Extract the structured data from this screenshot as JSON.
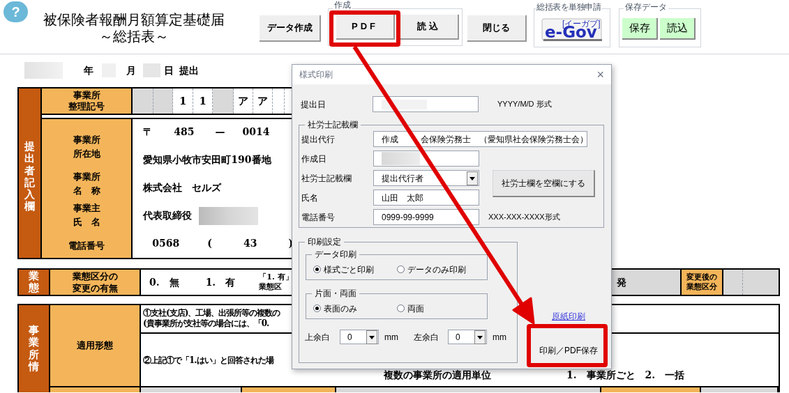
{
  "header": {
    "help": "?",
    "title": [
      "被保険者報酬月額算定基礎届",
      "～総括表～"
    ]
  },
  "toolbar": {
    "data_button": "データ作成",
    "create_group": {
      "label": "作成",
      "buttons": [
        {
          "label": "PDF",
          "highlighted": true
        },
        {
          "label": "読込",
          "highlighted": false
        }
      ]
    },
    "close_button": "閉じる",
    "egov_group": {
      "label": "総括表を単独申請",
      "logo": "e-Gov",
      "logo_reading": "[イーガブ]"
    },
    "save_group": {
      "label": "保存データ",
      "buttons": [
        "保存",
        "読込"
      ]
    }
  },
  "submission_date": [
    "年",
    "月",
    "日",
    "提出"
  ],
  "submitter_section": {
    "side_label": "提出者記入欄",
    "office_number": {
      "label": [
        "事業所",
        "整理記号"
      ],
      "cells": [
        {
          "kind": "blank"
        },
        {
          "kind": "blank"
        },
        {
          "kind": "char",
          "text": "1"
        },
        {
          "kind": "char",
          "text": "1"
        },
        {
          "kind": "blank"
        },
        {
          "kind": "char",
          "text": "ア"
        },
        {
          "kind": "char",
          "text": "ア"
        },
        {
          "kind": "empty"
        }
      ]
    },
    "labels": [
      [
        "事業所",
        "所在地"
      ],
      [
        "事業所",
        "名　称"
      ],
      [
        "事業主",
        "氏　名"
      ],
      [
        "電話番号"
      ]
    ],
    "postal": {
      "mark": "〒",
      "first": "485",
      "dash": "—",
      "second": "0014"
    },
    "address": "愛知県小牧市安田町190番地",
    "company": "株式会社　セルズ",
    "owner_title": "代表取締役",
    "phone": {
      "area": "0568",
      "open": "(",
      "local": "43",
      "close": ")"
    }
  },
  "business_type_section": {
    "side_label": "業態",
    "label": [
      "業態区分の",
      "変更の有無"
    ],
    "options": [
      "0.　無",
      "1.　有"
    ],
    "note": [
      "「1. 有」",
      "業態区"
    ],
    "partial": "発",
    "after_label": [
      "変更後の",
      "業態区分"
    ]
  },
  "office_info_section": {
    "side_label": "事業所情",
    "label": "適用形態",
    "notes": [
      "①支社(支店)、工場、出張所等の複数の",
      "(貴事業所が支社等の場合には、「0."
    ],
    "note2": "②上記①で「1.はい」と回答された場",
    "unit_label": "複数の事業所の適用単位",
    "unit_options": "1.　事業所ごと　2.　一括"
  },
  "dialog": {
    "title": "様式印刷",
    "close": "×",
    "submit_date": {
      "label": "提出日",
      "format": "YYYY/M/D 形式"
    },
    "sharoushi_group": {
      "label": "社労士記載欄",
      "fields": [
        {
          "kind": "wide",
          "label": "提出代行",
          "parts": [
            "作成",
            "会保険労務士　（愛知県社会保険労務士会）"
          ]
        },
        {
          "kind": "redacted",
          "label": "作成日"
        },
        {
          "kind": "select",
          "label": "社労士記載欄",
          "value": "提出代行者"
        },
        {
          "kind": "text",
          "label": "氏名",
          "value": "山田　太郎"
        },
        {
          "kind": "text",
          "label": "電話番号",
          "value": "0999-99-9999",
          "hint": "XXX-XXX-XXXX形式"
        }
      ],
      "clear_button": "社労士欄を空欄にする"
    },
    "print_group": {
      "label": "印刷設定",
      "options": [
        {
          "label": "データ印刷",
          "choices": [
            {
              "label": "様式ごと印刷",
              "selected": true
            },
            {
              "label": "データのみ印刷",
              "selected": false
            }
          ]
        },
        {
          "label": "片面・両面",
          "choices": [
            {
              "label": "表面のみ",
              "selected": true
            },
            {
              "label": "両面",
              "selected": false
            }
          ]
        }
      ],
      "margins": [
        {
          "label": "上余白",
          "value": "0",
          "unit": "mm"
        },
        {
          "label": "左余白",
          "value": "0",
          "unit": "mm"
        }
      ]
    },
    "original_print_link": "原紙印刷",
    "print_button": {
      "label": "印刷／PDF保存",
      "highlighted": true
    }
  }
}
